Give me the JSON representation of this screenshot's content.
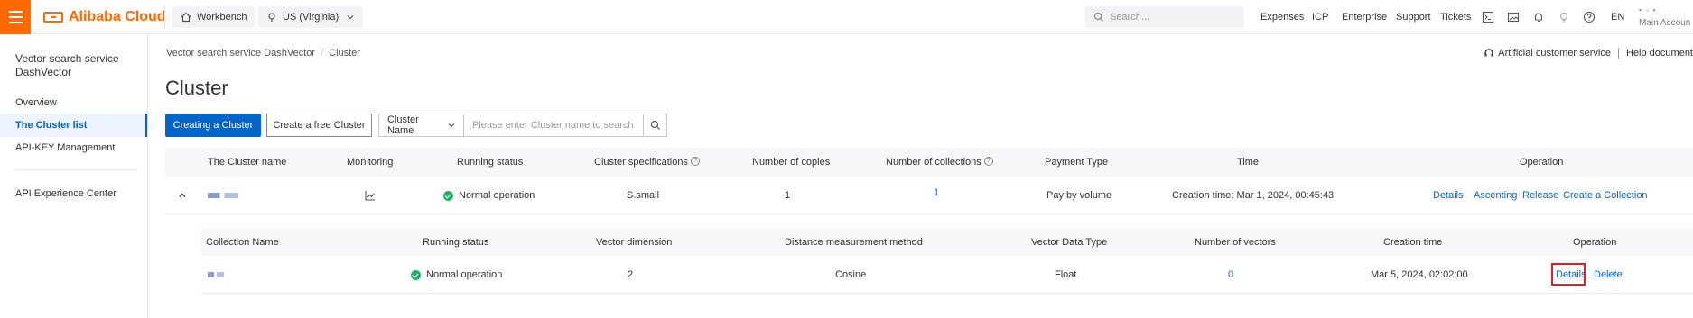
{
  "topbar": {
    "brand": "Alibaba Cloud",
    "workbench": "Workbench",
    "region": "US (Virginia)",
    "search_placeholder": "Search...",
    "links": [
      "Expenses",
      "ICP",
      "Enterprise",
      "Support",
      "Tickets"
    ],
    "lang": "EN",
    "account_label": "Main Accoun"
  },
  "sidebar": {
    "title": "Vector search service DashVector",
    "items": [
      {
        "label": "Overview"
      },
      {
        "label": "The Cluster list"
      },
      {
        "label": "API-KEY Management"
      },
      {
        "label": "API Experience Center"
      }
    ]
  },
  "breadcrumb": {
    "root": "Vector search service DashVector",
    "current": "Cluster"
  },
  "header_links": {
    "service": "Artificial customer service",
    "docs": "Help document"
  },
  "page": {
    "title": "Cluster"
  },
  "toolbar": {
    "create_button": "Creating a Cluster",
    "free_button": "Create a free Cluster",
    "filter_field": "Cluster Name",
    "filter_placeholder": "Please enter Cluster name to search"
  },
  "cluster_table": {
    "columns": [
      "The Cluster name",
      "Monitoring",
      "Running status",
      "Cluster specifications",
      "Number of copies",
      "Number of collections",
      "Payment Type",
      "Time",
      "Operation"
    ],
    "row": {
      "status": "Normal operation",
      "spec": "S.small",
      "copies": "1",
      "collections": "1",
      "payment": "Pay by volume",
      "time_label": "Creation time:",
      "time_value": "Mar 1, 2024, 00:45:43",
      "ops": [
        "Details",
        "Ascenting",
        "Release",
        "Create a Collection"
      ]
    }
  },
  "collection_table": {
    "columns": [
      "Collection Name",
      "Running status",
      "Vector dimension",
      "Distance measurement method",
      "Vector Data Type",
      "Number of vectors",
      "Creation time",
      "Operation"
    ],
    "row": {
      "status": "Normal operation",
      "dimension": "2",
      "metric": "Cosine",
      "dtype": "Float",
      "vectors": "0",
      "created": "Mar 5, 2024, 02:02:00",
      "ops": [
        "Details",
        "Delete"
      ]
    }
  },
  "colors": {
    "brand": "#ff6a00",
    "primary": "#0064c8",
    "success": "#23b066",
    "highlight": "#e02020"
  }
}
